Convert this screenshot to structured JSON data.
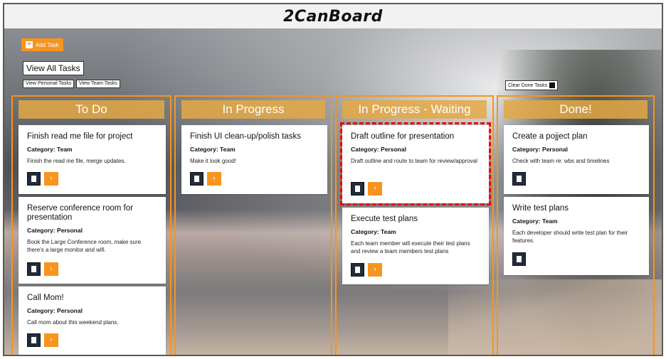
{
  "header": {
    "logo": "2CanBoard"
  },
  "toolbar": {
    "add_task": "Add Task",
    "view_all": "View All Tasks",
    "view_personal": "View Personal Tasks",
    "view_team": "View Team Tasks",
    "clear_done": "Clear Done Tasks"
  },
  "columns": [
    {
      "title": "To Do",
      "cards": [
        {
          "title": "Finish read me file for project",
          "category": "Category: Team",
          "description": "Finish the read me file, merge updates."
        },
        {
          "title": "Reserve conference room for presentation",
          "category": "Category: Personal",
          "description": "Book the Large Conference room, make sure there's a large monitor and wifi."
        },
        {
          "title": "Call Mom!",
          "category": "Category: Personal",
          "description": "Call mom about this weekend plans."
        }
      ]
    },
    {
      "title": "In Progress",
      "cards": [
        {
          "title": "Finish UI clean-up/polish tasks",
          "category": "Category: Team",
          "description": "Make it look good!"
        }
      ]
    },
    {
      "title": "In Progress - Waiting",
      "cards": [
        {
          "title": "Draft outline for presentation",
          "category": "Category: Personal",
          "description": "Draft outline and route to team for review/approval"
        },
        {
          "title": "Execute test plans",
          "category": "Category: Team",
          "description": "Each team member will execute their test plans and review a team members test plans"
        }
      ]
    },
    {
      "title": "Done!",
      "cards": [
        {
          "title": "Create a pojject plan",
          "category": "Category: Personal",
          "description": "Check with team re: wbs and timelines"
        },
        {
          "title": "Write test plans",
          "category": "Category: Team",
          "description": "Each developer should write test plan for their features."
        }
      ]
    }
  ],
  "icons": {
    "move": "chevron-right",
    "delete": "trash",
    "add": "plus",
    "clear": "trash"
  },
  "colors": {
    "accent": "#f7941d",
    "delete_button": "#212d3a",
    "highlight": "#e00000"
  }
}
